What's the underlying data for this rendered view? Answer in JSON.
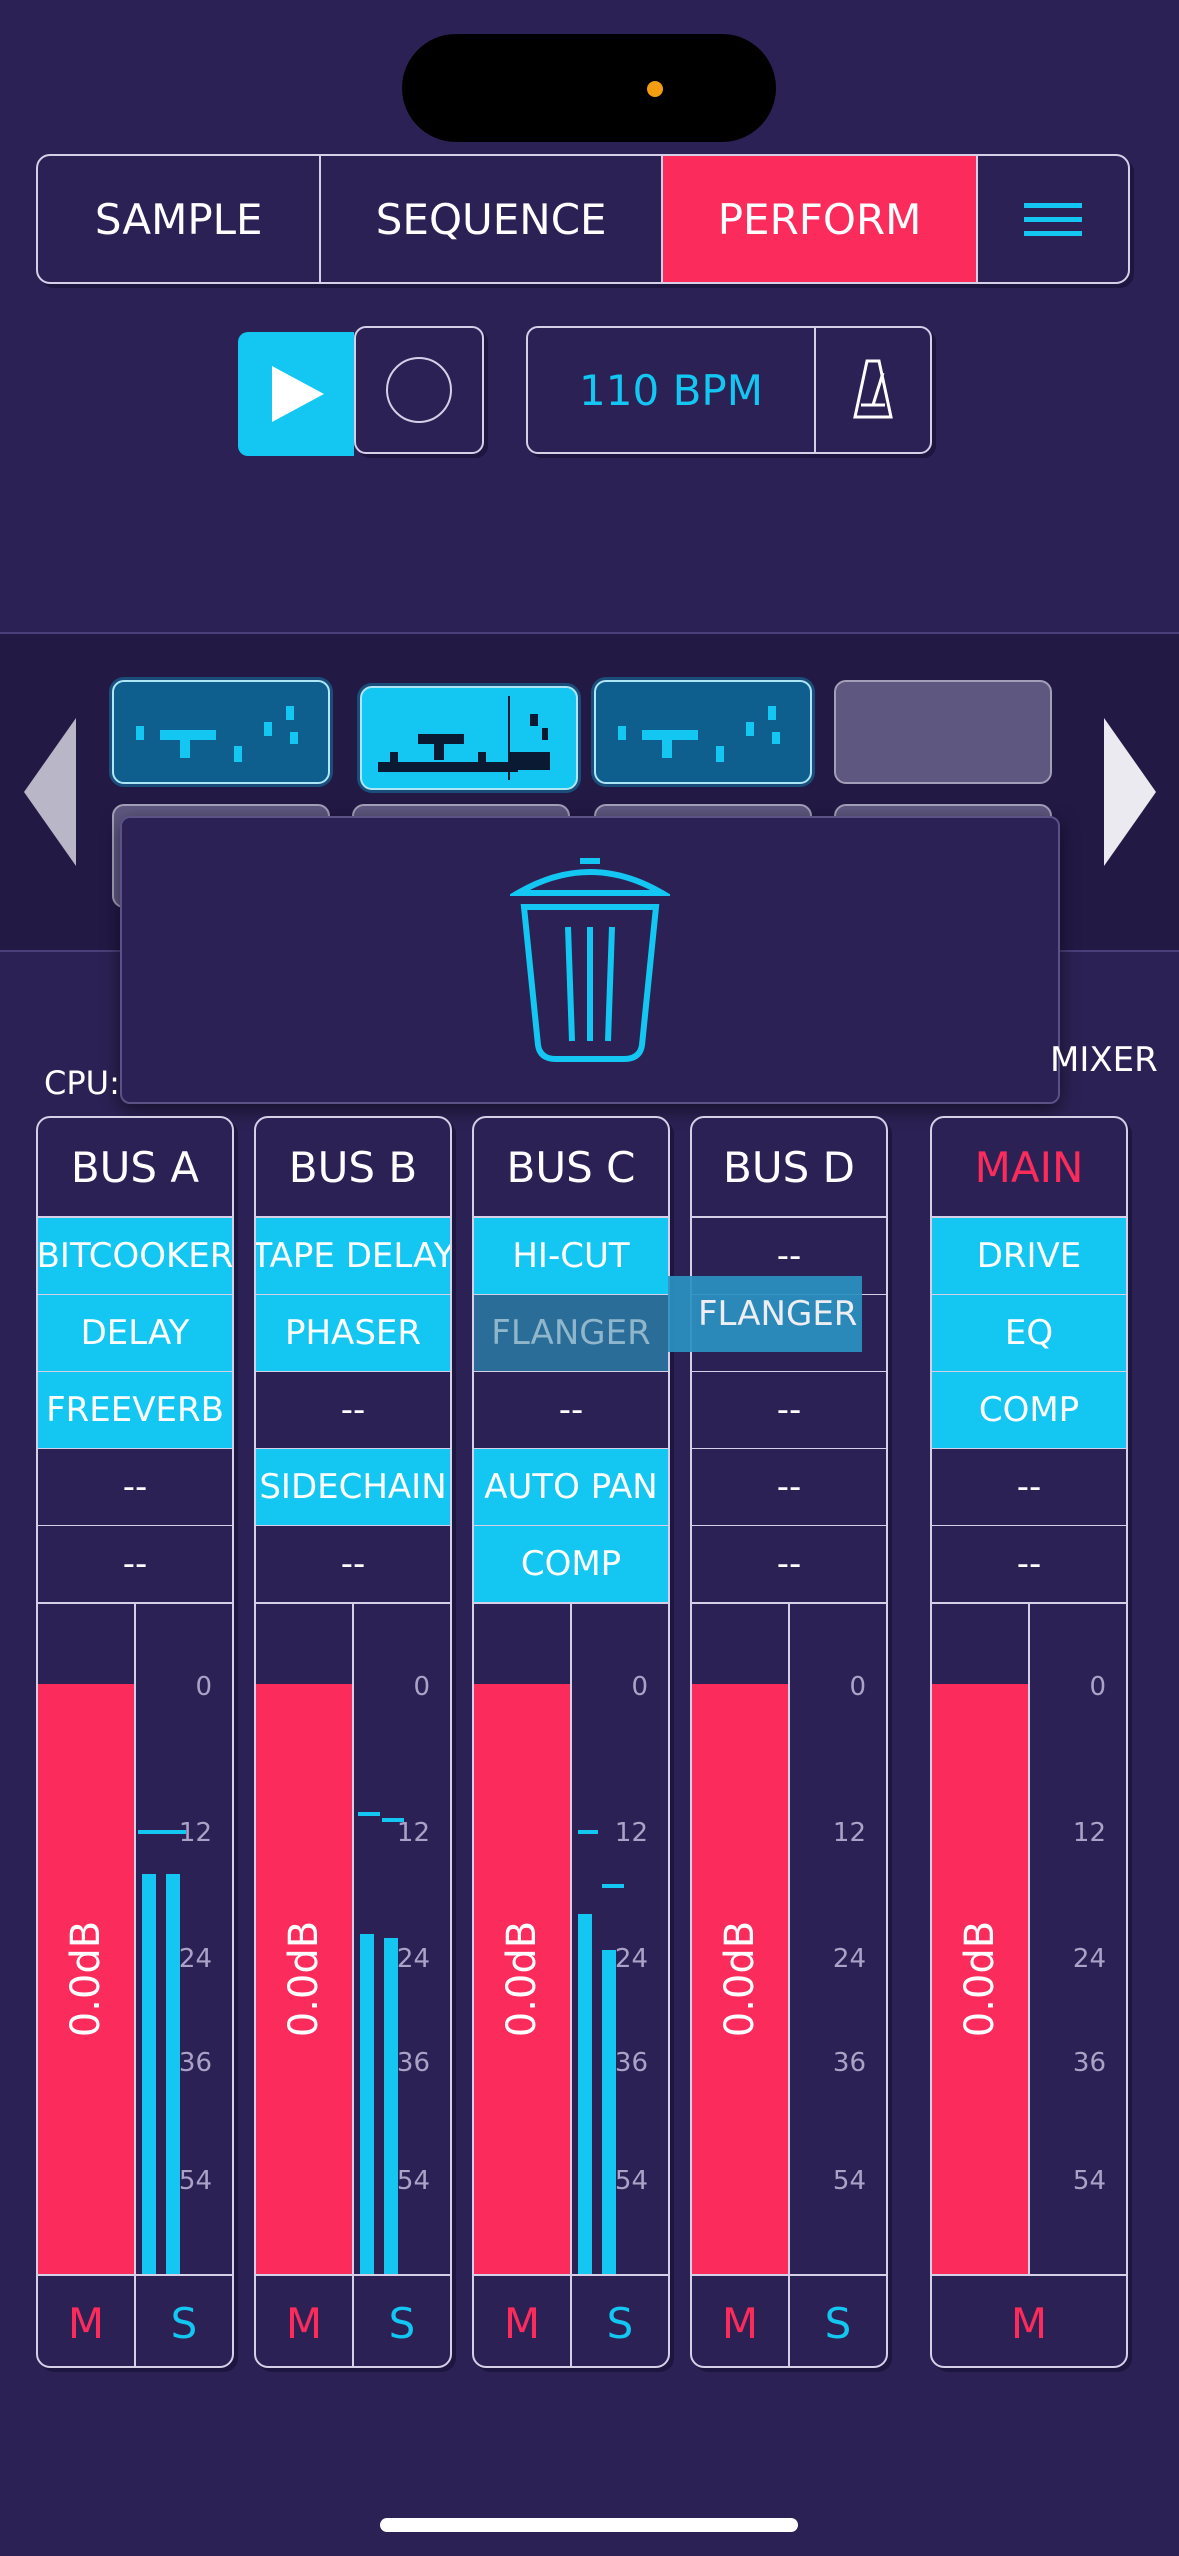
{
  "nav": {
    "tabs": [
      {
        "label": "SAMPLE",
        "active": false
      },
      {
        "label": "SEQUENCE",
        "active": false
      },
      {
        "label": "PERFORM",
        "active": true
      }
    ],
    "menu_icon": "hamburger-menu-icon"
  },
  "transport": {
    "play_icon": "play-icon",
    "record_icon": "record-icon",
    "bpm": "110 BPM",
    "metronome_icon": "metronome-icon"
  },
  "patterns": {
    "row1": [
      "filled",
      "selected",
      "filled",
      "empty"
    ],
    "prev_icon": "chevron-left-icon",
    "next_icon": "chevron-right-icon"
  },
  "trash": {
    "icon": "trash-icon"
  },
  "status": {
    "cpu_label": "CPU:",
    "mixer_label": "MIXER"
  },
  "buses": [
    {
      "name": "BUS A",
      "fx": [
        "BITCOOKER",
        "DELAY",
        "FREEVERB",
        "--",
        "--"
      ],
      "fader": "0.0dB",
      "mute": "M",
      "solo": "S"
    },
    {
      "name": "BUS B",
      "fx": [
        "TAPE DELAY",
        "PHASER",
        "--",
        "SIDECHAIN",
        "--"
      ],
      "fader": "0.0dB",
      "mute": "M",
      "solo": "S"
    },
    {
      "name": "BUS C",
      "fx": [
        "HI-CUT",
        "FLANGER",
        "--",
        "AUTO PAN",
        "COMP"
      ],
      "fader": "0.0dB",
      "mute": "M",
      "solo": "S"
    },
    {
      "name": "BUS D",
      "fx": [
        "--",
        "",
        "--",
        "--",
        "--"
      ],
      "fader": "0.0dB",
      "mute": "M",
      "solo": "S"
    },
    {
      "name": "MAIN",
      "fx": [
        "DRIVE",
        "EQ",
        "COMP",
        "--",
        "--"
      ],
      "fader": "0.0dB",
      "mute": "M"
    }
  ],
  "meter_scale": [
    "0",
    "12",
    "24",
    "36",
    "54"
  ],
  "drag_item": "FLANGER",
  "colors": {
    "background": "#2c2154",
    "accent": "#13c7f2",
    "active": "#fb2b5c"
  }
}
